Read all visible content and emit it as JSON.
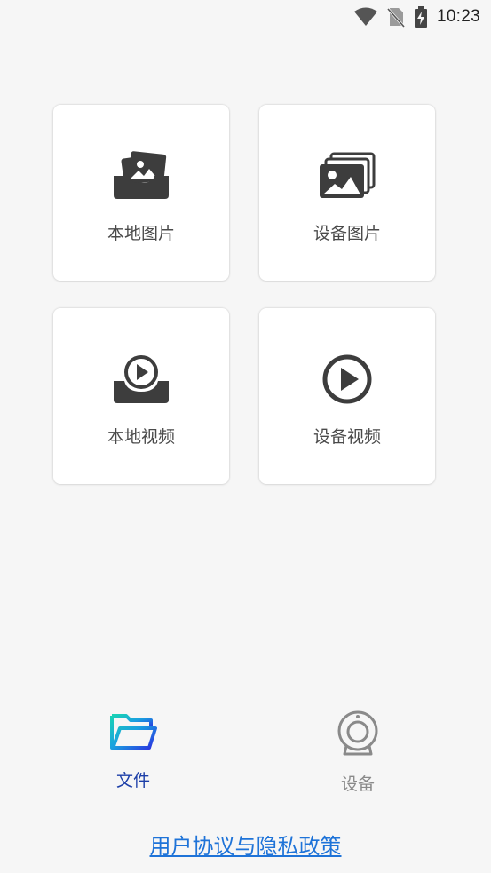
{
  "status_bar": {
    "time": "10:23",
    "icons": [
      "wifi-icon",
      "no-sim-icon",
      "battery-charging-icon"
    ]
  },
  "grid": {
    "cards": [
      {
        "label": "本地图片",
        "icon": "local-photo-icon"
      },
      {
        "label": "设备图片",
        "icon": "device-photos-icon"
      },
      {
        "label": "本地视频",
        "icon": "local-video-icon"
      },
      {
        "label": "设备视频",
        "icon": "play-circle-icon"
      }
    ]
  },
  "bottom_nav": {
    "tabs": [
      {
        "label": "文件",
        "icon": "folder-icon",
        "active": true
      },
      {
        "label": "设备",
        "icon": "camera-device-icon",
        "active": false
      }
    ]
  },
  "footer": {
    "privacy_link": "用户协议与隐私政策"
  },
  "colors": {
    "background": "#f6f6f6",
    "icon_dark": "#3d3d3d",
    "active_tab": "#1d3fa8",
    "inactive_tab": "#8a8a8a",
    "link": "#1e73d8"
  }
}
